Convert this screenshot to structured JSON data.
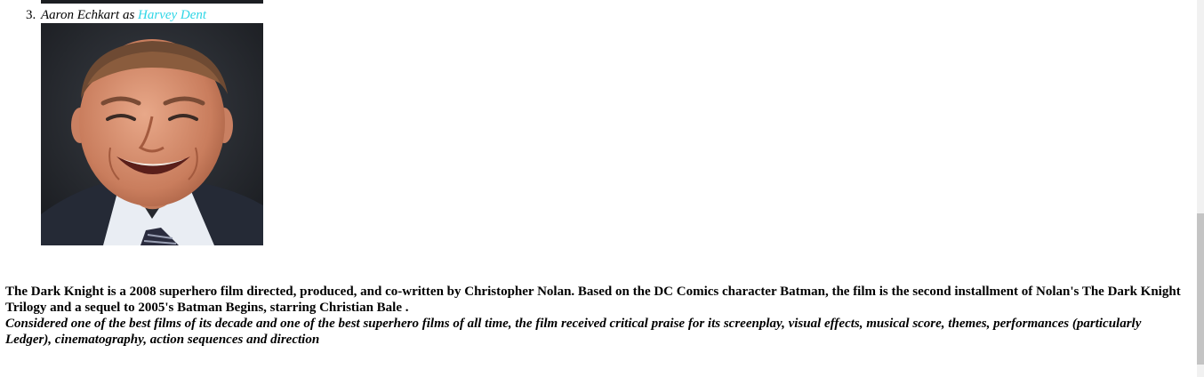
{
  "cast": {
    "number": "3.",
    "actor": "Aaron Echkart",
    "connector": " as ",
    "character": "Harvey Dent",
    "photo_icon": "person-portrait-photo"
  },
  "description": {
    "line1": "The Dark Knight is a 2008 superhero film directed, produced, and co-written by Christopher Nolan. Based on the DC Comics character Batman, the film is the second installment of Nolan's The Dark Knight Trilogy and a sequel to 2005's Batman Begins, starring Christian Bale .",
    "line2": "Considered one of the best films of its decade and one of the best superhero films of all time, the film received critical praise for its screenplay, visual effects, musical score, themes, performances (particularly Ledger), cinematography, action sequences and direction"
  },
  "colors": {
    "link": "#2fd6e6",
    "text": "#000000",
    "background": "#ffffff"
  }
}
